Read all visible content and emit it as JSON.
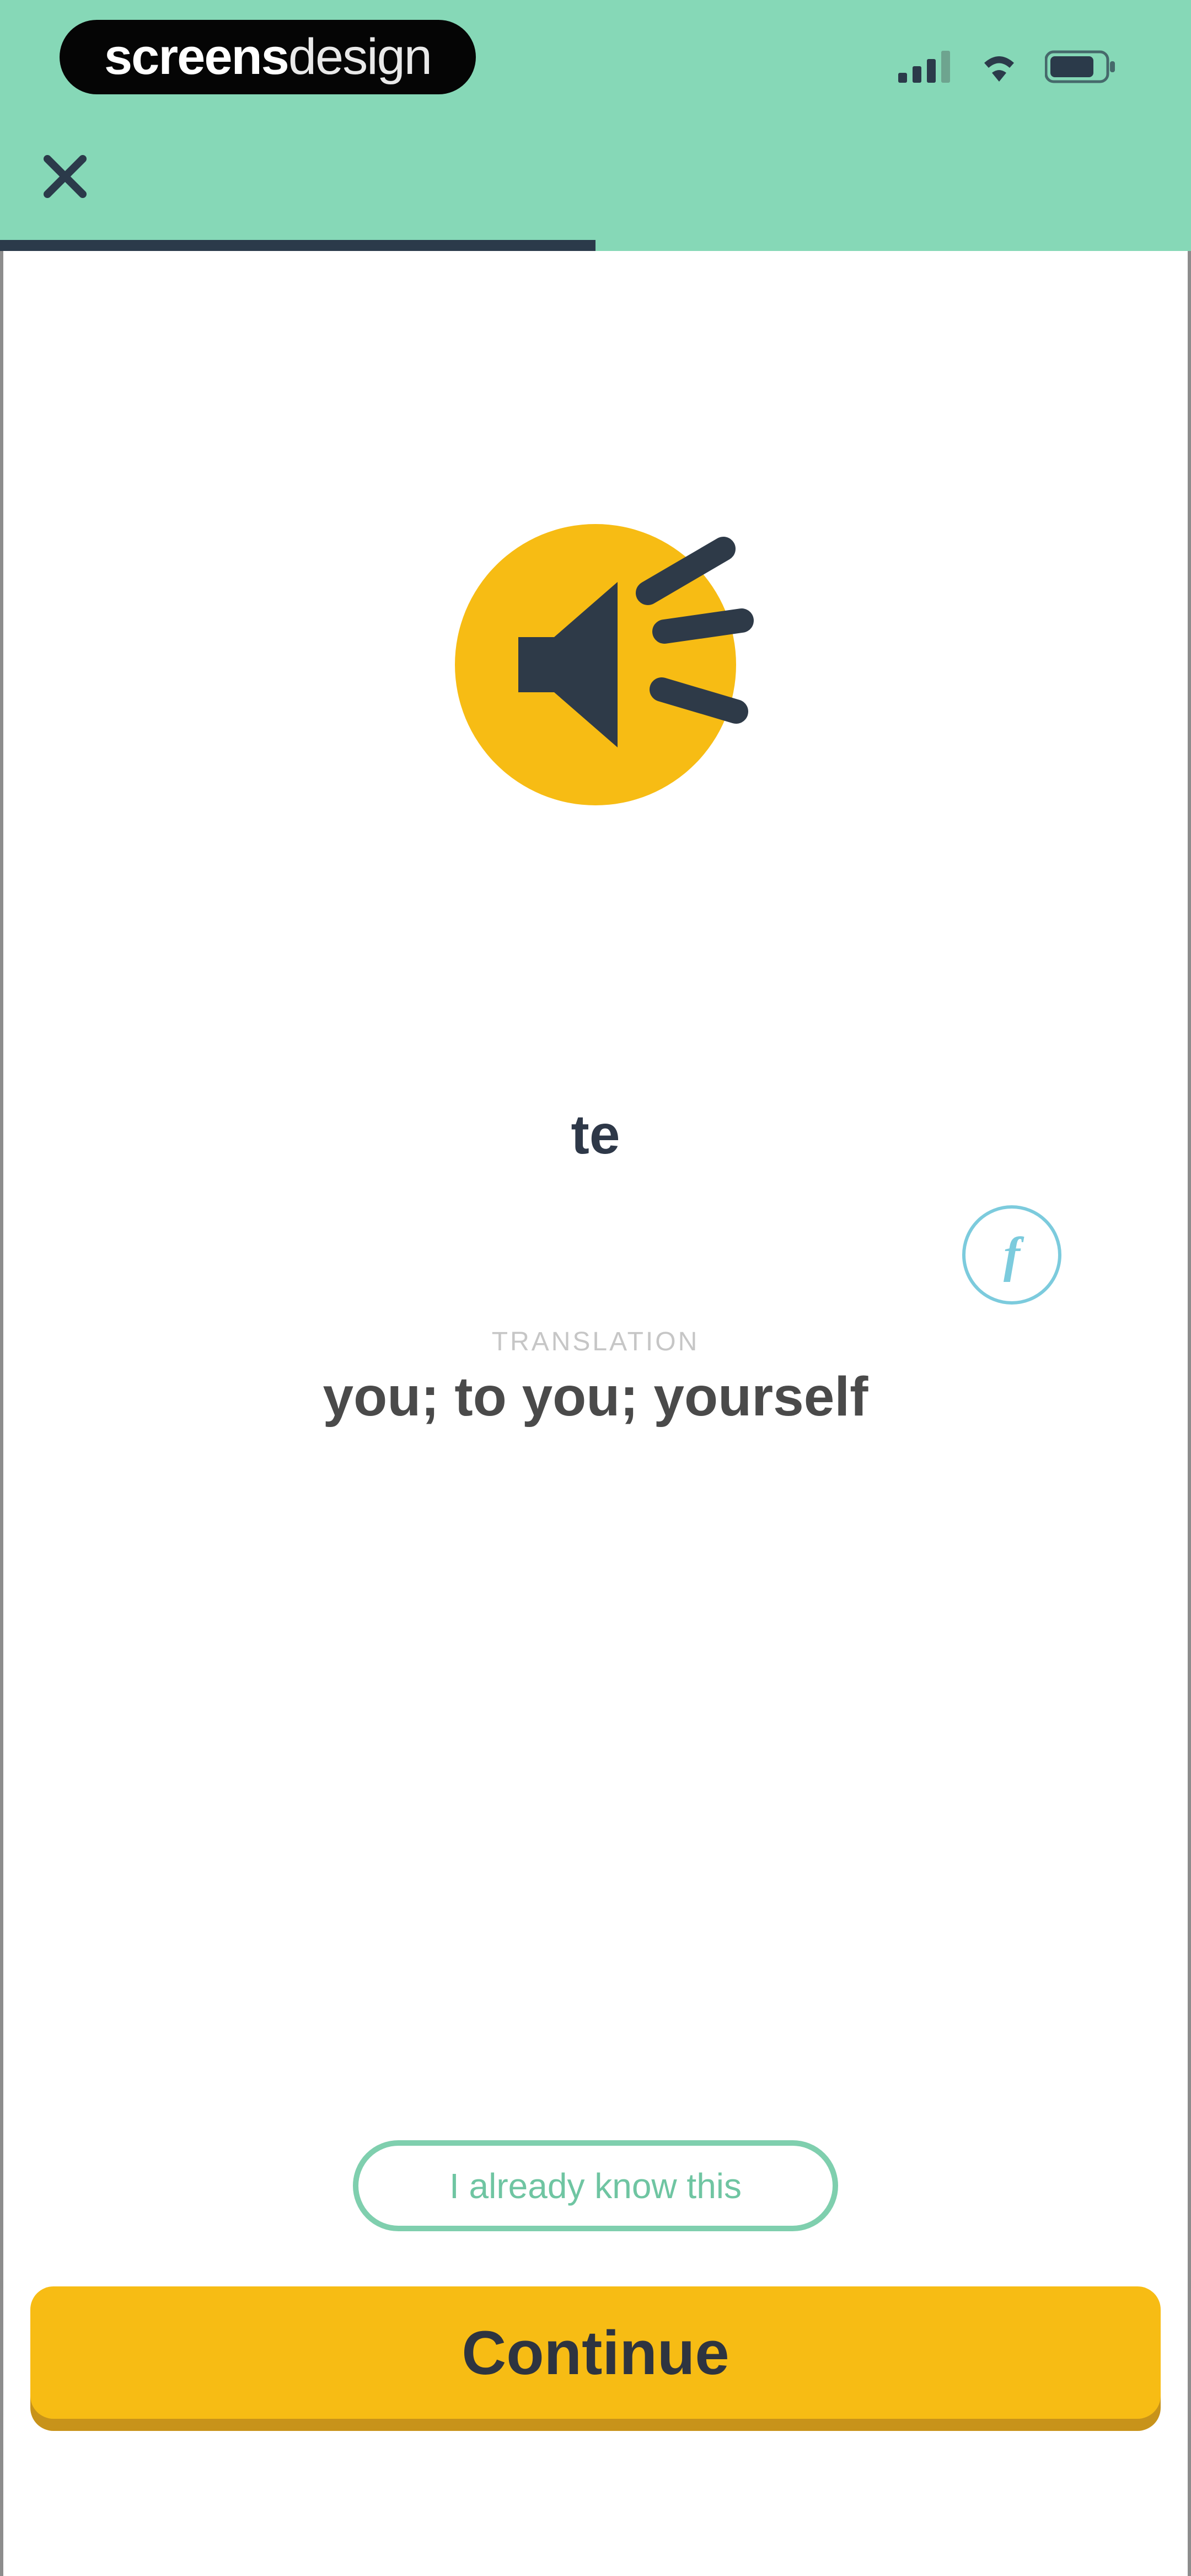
{
  "app": {
    "brand": {
      "bold": "screens",
      "light": "design"
    },
    "status_icons": [
      "signal-icon",
      "wifi-icon",
      "battery-icon"
    ],
    "colors": {
      "header_bg": "#86D8B7",
      "accent_yellow": "#F7BC14",
      "dark": "#2E3848",
      "teal_outline": "#7FCFAE",
      "hint_blue": "#7CCBDD"
    }
  },
  "header": {
    "close_icon": "close-icon",
    "progress": 0.5
  },
  "lesson": {
    "audio_icon": "speaker-icon",
    "word": "te",
    "hint_label": "f",
    "translation_label": "TRANSLATION",
    "translation": "you; to you; yourself"
  },
  "actions": {
    "already_know": "I already know this",
    "continue": "Continue"
  }
}
